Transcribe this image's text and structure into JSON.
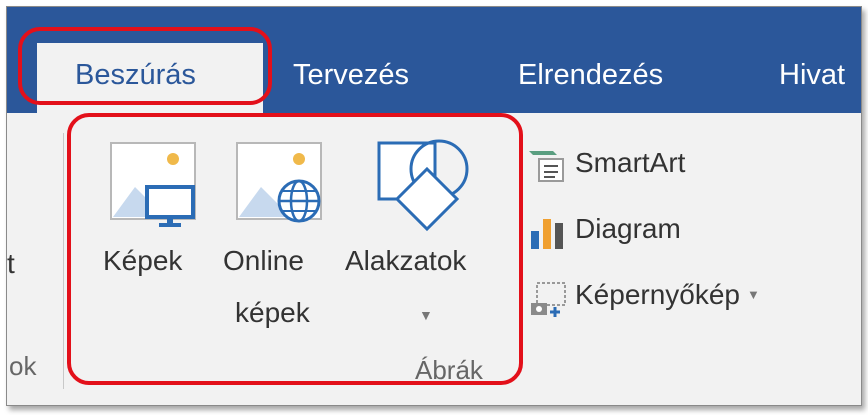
{
  "tabs": {
    "insert": "Beszúrás",
    "design": "Tervezés",
    "layout": "Elrendezés",
    "references": "Hivat"
  },
  "ribbon": {
    "left_cut_label": "t",
    "left_cut_group": "ok",
    "pictures": "Képek",
    "online_pictures_line1": "Online",
    "online_pictures_line2": "képek",
    "shapes": "Alakzatok",
    "smartart": "SmartArt",
    "chart": "Diagram",
    "screenshot": "Képernyőkép",
    "group_illustrations": "Ábrák"
  },
  "colors": {
    "accent": "#2b579a",
    "highlight": "#e3101a"
  }
}
